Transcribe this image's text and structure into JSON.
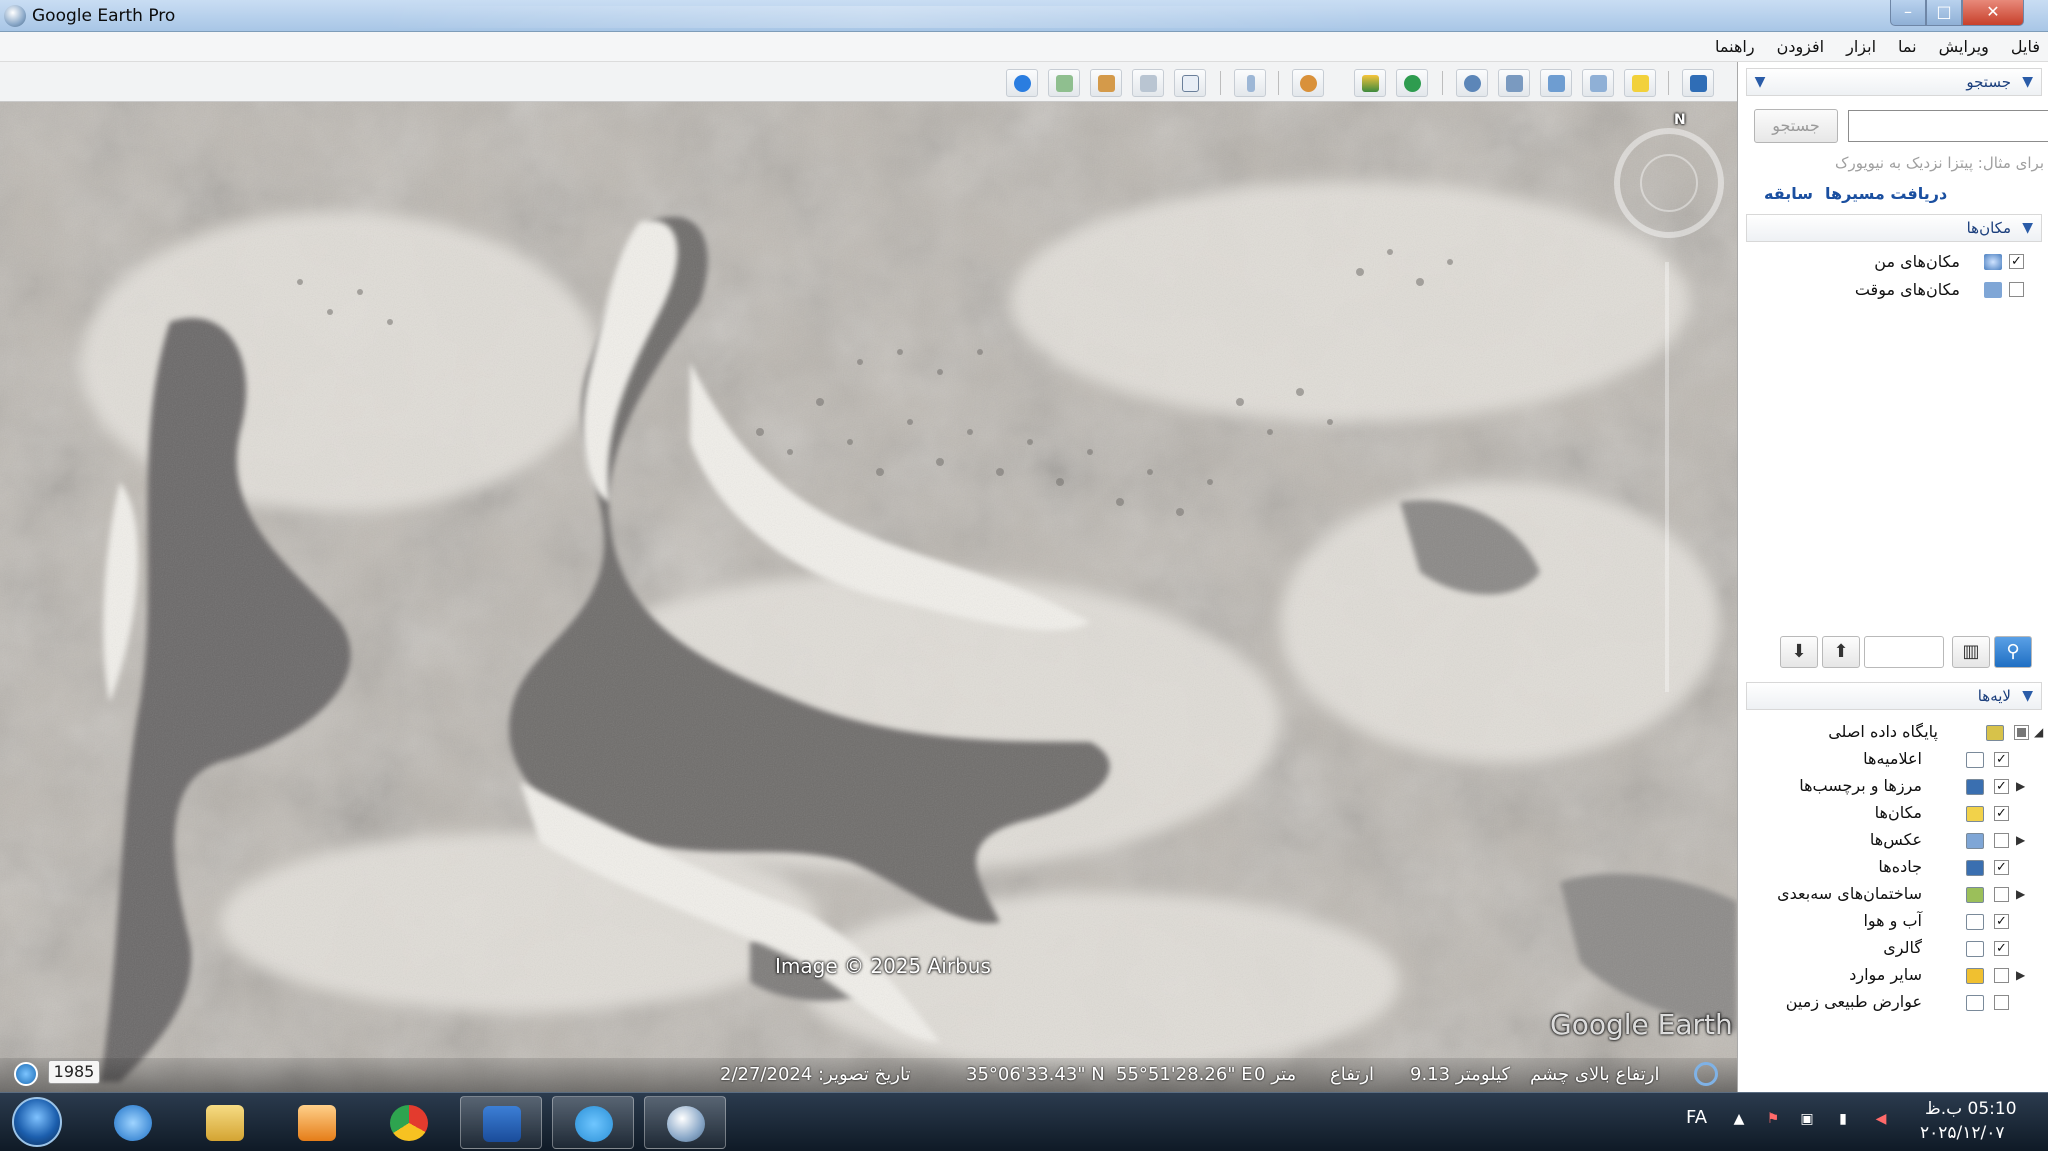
{
  "window": {
    "title": "Google Earth Pro",
    "close_glyph": "✕",
    "max_glyph": "□",
    "min_glyph": "–"
  },
  "menu": [
    "فایل",
    "ویرایش",
    "نما",
    "ابزار",
    "افزودن",
    "راهنما"
  ],
  "toolbar": {
    "icons": [
      "sidebar-toggle-icon",
      "placemark-icon",
      "polygon-icon",
      "path-icon",
      "image-overlay-icon",
      "record-tour-icon",
      "historical-imagery-icon",
      "sunlight-icon",
      "planets-icon",
      "ruler-icon",
      "email-icon",
      "print-icon",
      "save-image-icon",
      "view-in-maps-icon",
      "web-icon"
    ]
  },
  "search": {
    "header": "جستجو",
    "button_label": "جستجو",
    "hint": "برای مثال: پیتزا نزدیک به نیویورک",
    "link_directions": "دریافت مسیرها",
    "link_history": "سابقه"
  },
  "places": {
    "header": "مکان‌ها",
    "items": [
      {
        "label": "مکان‌های من",
        "checked": true
      },
      {
        "label": "مکان‌های موقت",
        "checked": false
      }
    ],
    "up_glyph": "⬆",
    "down_glyph": "⬇"
  },
  "layers": {
    "header": "لایه‌ها",
    "items": [
      {
        "label": "پایگاه داده اصلی",
        "checked": "partial",
        "icon_color": "#d7c24a"
      },
      {
        "label": "اعلامیه‌ها",
        "checked": true,
        "icon_color": "#ffffff"
      },
      {
        "label": "مرزها و برچسب‌ها",
        "checked": true,
        "icon_color": "#3a6fb0"
      },
      {
        "label": "مکان‌ها",
        "checked": true,
        "icon_color": "#f2d24a"
      },
      {
        "label": "عکس‌ها",
        "checked": false,
        "icon_color": "#7fa6d6"
      },
      {
        "label": "جاده‌ها",
        "checked": true,
        "icon_color": "#3a6fb0"
      },
      {
        "label": "ساختمان‌های سه‌بعدی",
        "checked": false,
        "icon_color": "#9bbf5a"
      },
      {
        "label": "آب و هوا",
        "checked": true,
        "icon_color": "#ffffff"
      },
      {
        "label": "گالری",
        "checked": true,
        "icon_color": "#ffffff"
      },
      {
        "label": "سایر موارد",
        "checked": false,
        "icon_color": "#f0c030"
      },
      {
        "label": "عوارض طبیعی زمین",
        "checked": false,
        "icon_color": "#ffffff"
      }
    ]
  },
  "map": {
    "attribution": "Image © 2025 Airbus",
    "watermark": "Google Earth",
    "north": "N"
  },
  "status": {
    "year": "1985",
    "date": "تاریخ تصویر: 2/27/2024",
    "lat": "35°06'33.43\" N",
    "lon": "55°51'28.26\" E",
    "elev_value": "0 متر",
    "elev_label": "ارتفاع",
    "eye_value": "9.13 کیلومتر",
    "eye_label": "ارتفاع بالای چشم"
  },
  "taskbar": {
    "apps": [
      "internet-explorer",
      "file-explorer",
      "media-player",
      "chrome",
      "word",
      "telegram",
      "google-earth-pro"
    ],
    "lang": "FA",
    "time": "05:10 ب.ظ",
    "date": "۲۰۲۵/۱۲/۰۷"
  }
}
